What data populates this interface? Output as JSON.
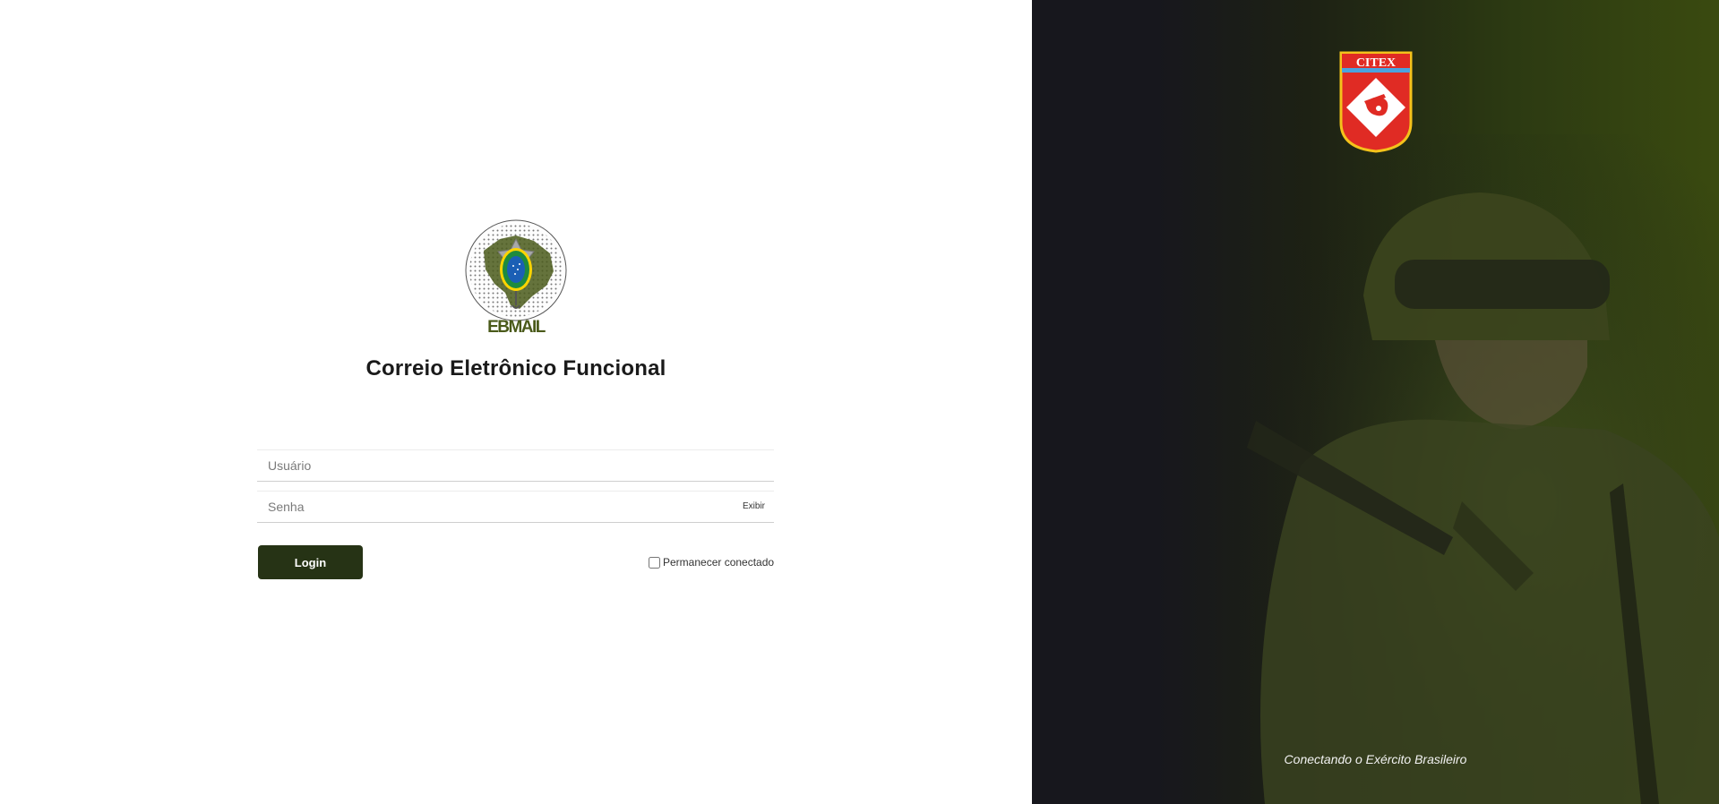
{
  "login_panel": {
    "logo_text": "EBMAIL",
    "title": "Correio Eletrônico Funcional",
    "username_placeholder": "Usuário",
    "password_placeholder": "Senha",
    "show_password_label": "Exibir",
    "login_button_label": "Login",
    "remember_label": "Permanecer conectado"
  },
  "banner": {
    "emblem_text": "CITEX",
    "tagline": "Conectando o Exército Brasileiro"
  },
  "colors": {
    "primary_button": "#263315",
    "banner_dark": "#17171d",
    "banner_olive": "#3a4a10"
  }
}
